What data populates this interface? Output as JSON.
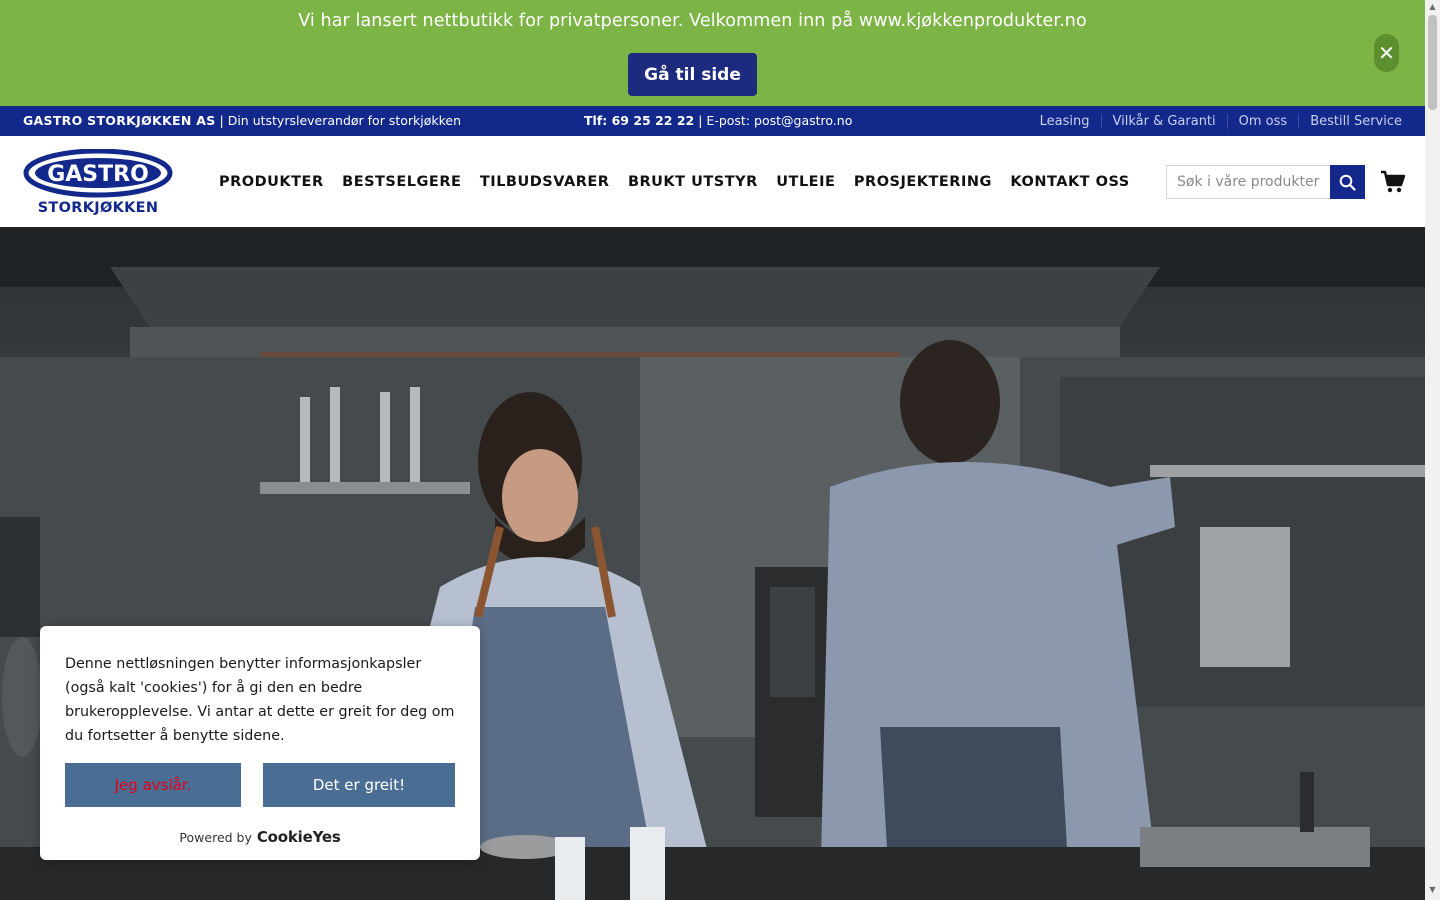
{
  "announcement": {
    "text": "Vi har lansert nettbutikk for privatpersoner. Velkommen inn på www.kjøkkenprodukter.no",
    "button_label": "Gå til side",
    "close_label": "✕"
  },
  "topbar": {
    "company": "GASTRO STORKJØKKEN AS",
    "separator": "|",
    "tagline": "Din utstyrsleverandør for storkjøkken",
    "phone": "Tlf: 69 25 22 22",
    "email": "| E-post: post@gastro.no",
    "links": [
      "Leasing",
      "Vilkår & Garanti",
      "Om oss",
      "Bestill Service"
    ]
  },
  "header": {
    "logo_top": "GASTRO",
    "logo_bottom": "STORKJØKKEN",
    "nav": [
      "PRODUKTER",
      "BESTSELGERE",
      "TILBUDSVARER",
      "BRUKT UTSTYR",
      "UTLEIE",
      "PROSJEKTERING",
      "KONTAKT OSS"
    ],
    "search_placeholder": "Søk i våre produkter"
  },
  "cookie": {
    "text": "Denne nettløsningen benytter informasjonkapsler (også kalt 'cookies') for å gi den en bedre brukeropplevelse. Vi antar at dette er greit for deg om du fortsetter å benytte sidene.",
    "decline_label": "Jeg avslår.",
    "accept_label": "Det er greit!",
    "powered_by": "Powered by",
    "brand": "CookieYes"
  },
  "colors": {
    "announcement_bg": "#7db446",
    "brand_navy": "#12288a",
    "button_navy": "#1c2b7d",
    "cookie_button": "#4a6d94",
    "decline_text": "#e4001b"
  }
}
